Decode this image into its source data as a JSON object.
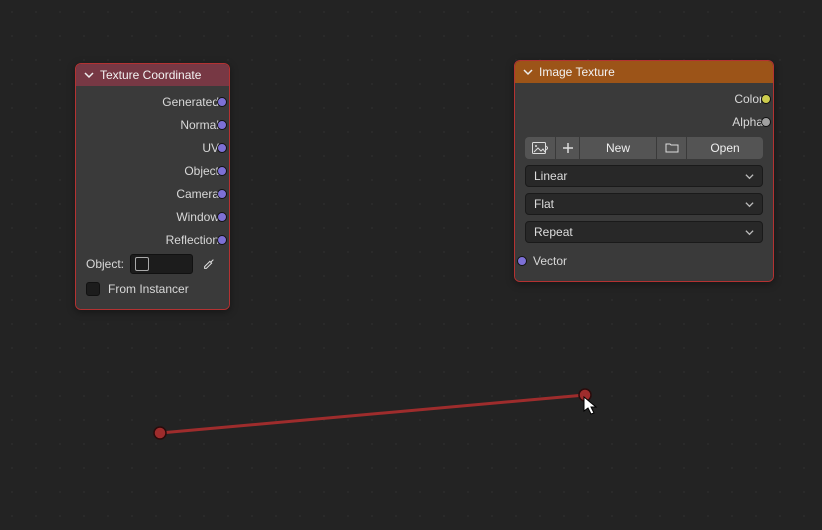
{
  "nodes": {
    "texcoord": {
      "title": "Texture Coordinate",
      "outputs": [
        "Generated",
        "Normal",
        "UV",
        "Object",
        "Camera",
        "Window",
        "Reflection"
      ],
      "object_label": "Object:",
      "from_instancer": "From Instancer"
    },
    "imgtex": {
      "title": "Image Texture",
      "outputs": {
        "color": "Color",
        "alpha": "Alpha"
      },
      "new_label": "New",
      "open_label": "Open",
      "interp": "Linear",
      "projection": "Flat",
      "extension": "Repeat",
      "vector_label": "Vector"
    }
  },
  "colors": {
    "selection": "#b43232"
  }
}
